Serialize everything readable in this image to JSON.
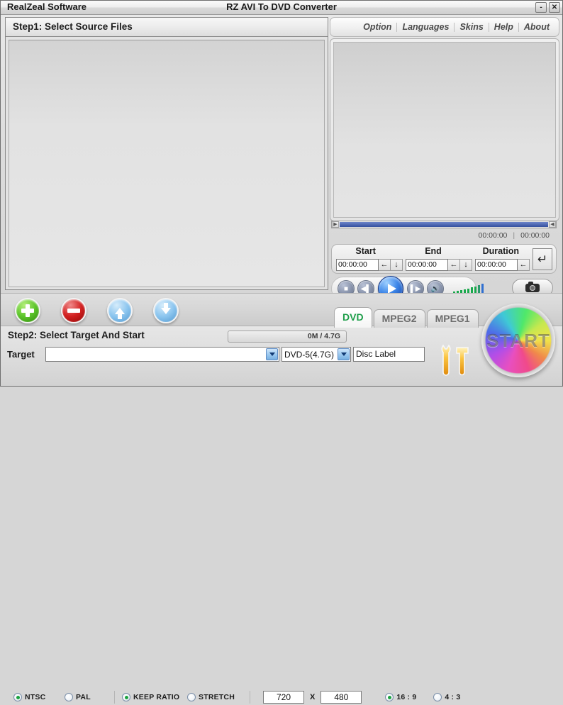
{
  "titlebar": {
    "company": "RealZeal Software",
    "app_title": "RZ AVI To DVD Converter",
    "minimize_label": "-",
    "close_label": "✕"
  },
  "step1": {
    "heading": "Step1: Select Source Files",
    "file_list_items": []
  },
  "menu": {
    "items": [
      {
        "label": "Option"
      },
      {
        "label": "Languages"
      },
      {
        "label": "Skins"
      },
      {
        "label": "Help"
      },
      {
        "label": "About"
      }
    ]
  },
  "preview": {
    "current_time": "00:00:00",
    "total_time": "00:00:00",
    "separator": "|"
  },
  "trim": {
    "start_label": "Start",
    "end_label": "End",
    "duration_label": "Duration",
    "start_value": "00:00:00",
    "end_value": "00:00:00",
    "duration_value": "00:00:00",
    "set_left_glyph": "←",
    "set_down_glyph": "↓",
    "enter_glyph": "↵"
  },
  "transport": {
    "stop_glyph": "■",
    "prev_glyph": "⏮",
    "play_label": "play",
    "next_glyph": "⏭",
    "volume_glyph": "◀",
    "snapshot_label": "snapshot",
    "vu_bars": [
      5,
      6,
      7,
      8,
      9,
      11,
      12,
      14,
      16
    ]
  },
  "toolbar": {
    "add_label": "Add Files",
    "remove_label": "Remove",
    "move_up_label": "Move Up",
    "move_down_label": "Move Down"
  },
  "tabs": [
    {
      "label": "DVD",
      "active": true
    },
    {
      "label": "MPEG2",
      "active": false
    },
    {
      "label": "MPEG1",
      "active": false
    }
  ],
  "step2": {
    "heading": "Step2: Select Target And Start",
    "progress_text": "0M / 4.7G",
    "target_label": "Target",
    "target_value": "",
    "target_placeholder": "",
    "disc_type_value": "DVD-5(4.7G)",
    "disc_label_value": "Disc Label",
    "start_label": "START",
    "tools_label": "Settings"
  },
  "options": {
    "tv_systems": [
      {
        "label": "NTSC",
        "selected": true
      },
      {
        "label": "PAL",
        "selected": false
      }
    ],
    "scaling": [
      {
        "label": "KEEP RATIO",
        "selected": true
      },
      {
        "label": "STRETCH",
        "selected": false
      }
    ],
    "width_value": "720",
    "height_value": "480",
    "x_label": "X",
    "aspect": [
      {
        "label": "16 : 9",
        "selected": true
      },
      {
        "label": "4 : 3",
        "selected": false
      }
    ]
  },
  "colors": {
    "accent_green": "#1e9e4a",
    "play_blue": "#3d86e8",
    "add_green": "#5cc52a",
    "remove_red": "#d22020",
    "move_blue": "#8dc6ef"
  }
}
